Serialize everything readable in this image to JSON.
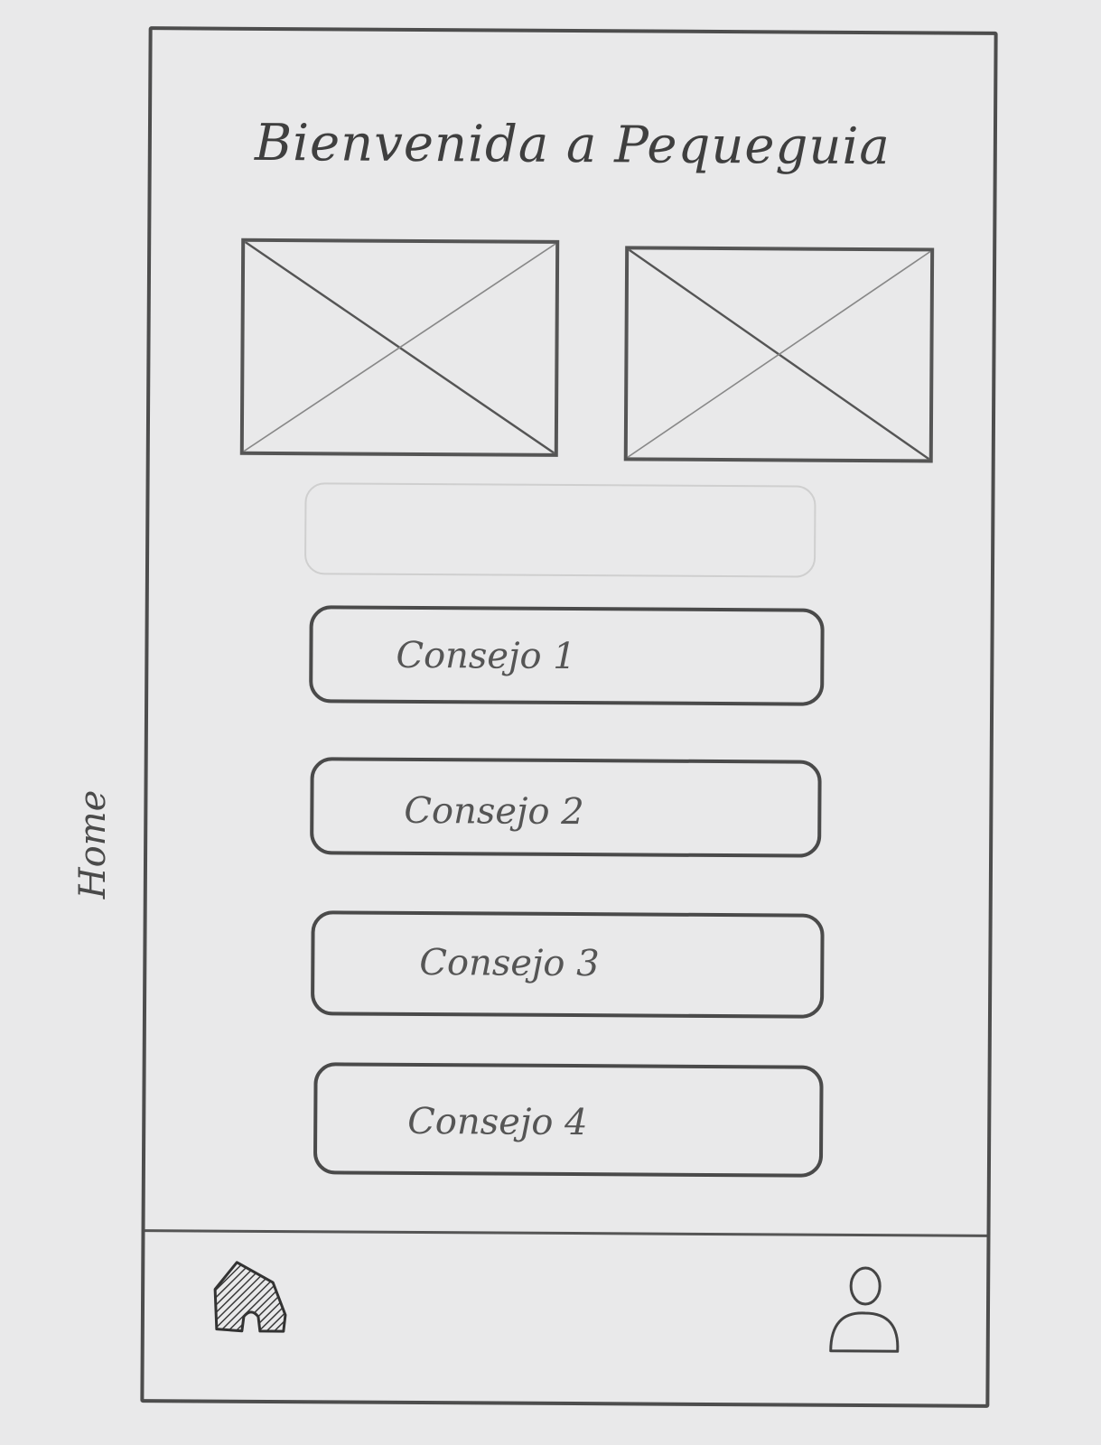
{
  "side_label": "Home",
  "header": {
    "title": "Bienvenida a Pequeguia"
  },
  "images": [
    {
      "name": "placeholder-image"
    },
    {
      "name": "placeholder-image"
    }
  ],
  "tips": [
    {
      "label": "Consejo 1"
    },
    {
      "label": "Consejo 2"
    },
    {
      "label": "Consejo 3"
    },
    {
      "label": "Consejo 4"
    }
  ],
  "bottom_nav": {
    "items": [
      {
        "icon": "home-icon"
      },
      {
        "icon": "user-icon"
      }
    ]
  },
  "colors": {
    "paper": "#e9e9ea",
    "pencil": "#4a4a4a"
  }
}
